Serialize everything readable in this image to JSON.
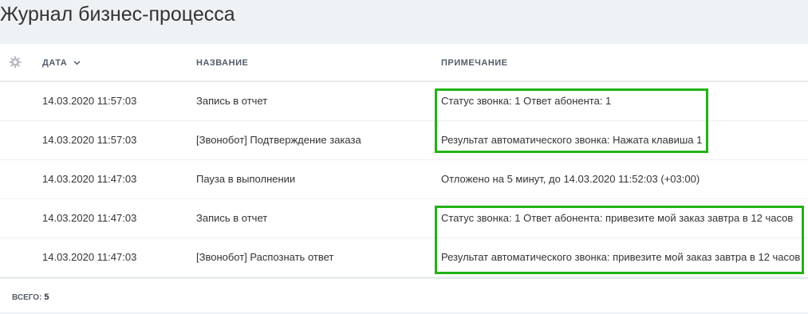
{
  "page": {
    "title": "Журнал бизнес-процесса"
  },
  "table": {
    "settings_icon": "gear-icon",
    "columns": {
      "date": "ДАТА",
      "name": "НАЗВАНИЕ",
      "note": "ПРИМЕЧАНИЕ"
    },
    "sort_icon": "chevron-down-icon",
    "rows": [
      {
        "date": "14.03.2020 11:57:03",
        "name": "Запись в отчет",
        "note": "Статус звонка: 1 Ответ абонента: 1"
      },
      {
        "date": "14.03.2020 11:57:03",
        "name": "[Звонобот] Подтверждение заказа",
        "note": "Результат автоматического звонка: Нажата клавиша 1"
      },
      {
        "date": "14.03.2020 11:47:03",
        "name": "Пауза в выполнении",
        "note": "Отложено на 5 минут, до 14.03.2020 11:52:03 (+03:00)"
      },
      {
        "date": "14.03.2020 11:47:03",
        "name": "Запись в отчет",
        "note": "Статус звонка: 1 Ответ абонента: привезите мой заказ завтра в 12 часов"
      },
      {
        "date": "14.03.2020 11:47:03",
        "name": "[Звонобот] Распознать ответ",
        "note": "Результат автоматического звонка: привезите мой заказ завтра в 12 часов"
      }
    ]
  },
  "footer": {
    "total_label": "ВСЕГО:",
    "total_value": "5"
  },
  "colors": {
    "highlight": "#22b314",
    "background": "#eef2f4"
  }
}
